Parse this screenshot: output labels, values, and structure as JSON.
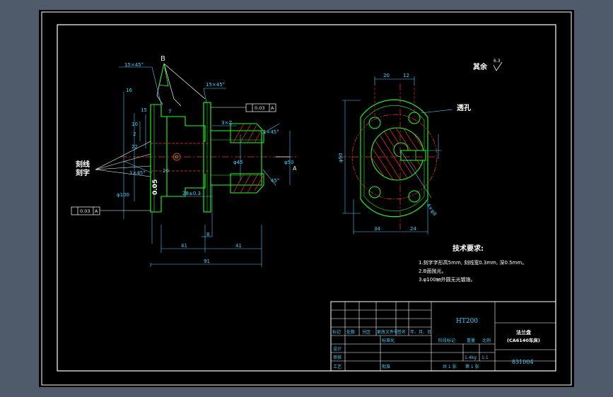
{
  "colors": {
    "background": "#4f5a6a",
    "canvas": "#000000",
    "border": "#ffffff",
    "outline": "#20ff20",
    "dimension": "#3fd0ff",
    "centerline": "#ff3030",
    "hatch": "#ff3030",
    "text": "#ffffff",
    "label_yellow": "#ffff40"
  },
  "side_view": {
    "chamfer_top": "15×45°",
    "chamfer_mid": "15×45°",
    "letter_b": "B",
    "dim_16": "16",
    "dim_15": "15",
    "dim_10": "10",
    "dim_2": "2",
    "dim_20": "20",
    "dim_22": "22",
    "dim_7": "7",
    "dim_phi100": "φ100",
    "chamfer_1x45": "1×45°",
    "dim_3xz": "3×Z",
    "dim_chamfer_right": "1×45°",
    "dim_phi45": "φ45",
    "dim_phi50": "φ50",
    "dim_28": "28±0.3",
    "dim_8": "8",
    "dim_41_left": "41",
    "dim_41_right": "41",
    "dim_91": "91",
    "tol_left_value": "0.03",
    "tol_left_ref": "A",
    "tol_right_value": "0.03",
    "tol_right_ref": "A",
    "label_engrave_line": "刻线",
    "label_engrave_char": "刻字",
    "engraved_number": "0.05",
    "datum_a": "A",
    "angle_45": "45°"
  },
  "front_view": {
    "roughness_note": "其余",
    "roughness_value": "6.3",
    "dim_20": "20",
    "dim_12": "12",
    "through_hole": "透孔",
    "dim_phi90": "φ90",
    "dim_34": "34",
    "dim_24": "24",
    "hole_dim": "4×φ8"
  },
  "tech_requirements": {
    "title": "技术要求:",
    "items": [
      "1.刻字字形高5mm, 刻线宽0.3mm, 深0.5mm。",
      "2.B面抛光。",
      "3.φ100㎜外圆无光镀铬。"
    ]
  },
  "title_block": {
    "material": "HT200",
    "part_name_line1": "法兰盘",
    "part_name_line2": "(CA6140车床)",
    "drawing_number": "831004",
    "weight": "1.4kg",
    "scale": "1:1",
    "header_labels": [
      "标记",
      "处数",
      "分区",
      "更改文件号",
      "签名",
      "年、月、日"
    ],
    "row_labels": [
      "设计",
      "审核",
      "工艺"
    ],
    "standardization": "标准化",
    "approve": "批准",
    "stage_mark": "阶段标记",
    "weight_label": "重量",
    "scale_label": "比例",
    "sheets_total": "共 1 张",
    "sheet_no": "第 1 张"
  }
}
